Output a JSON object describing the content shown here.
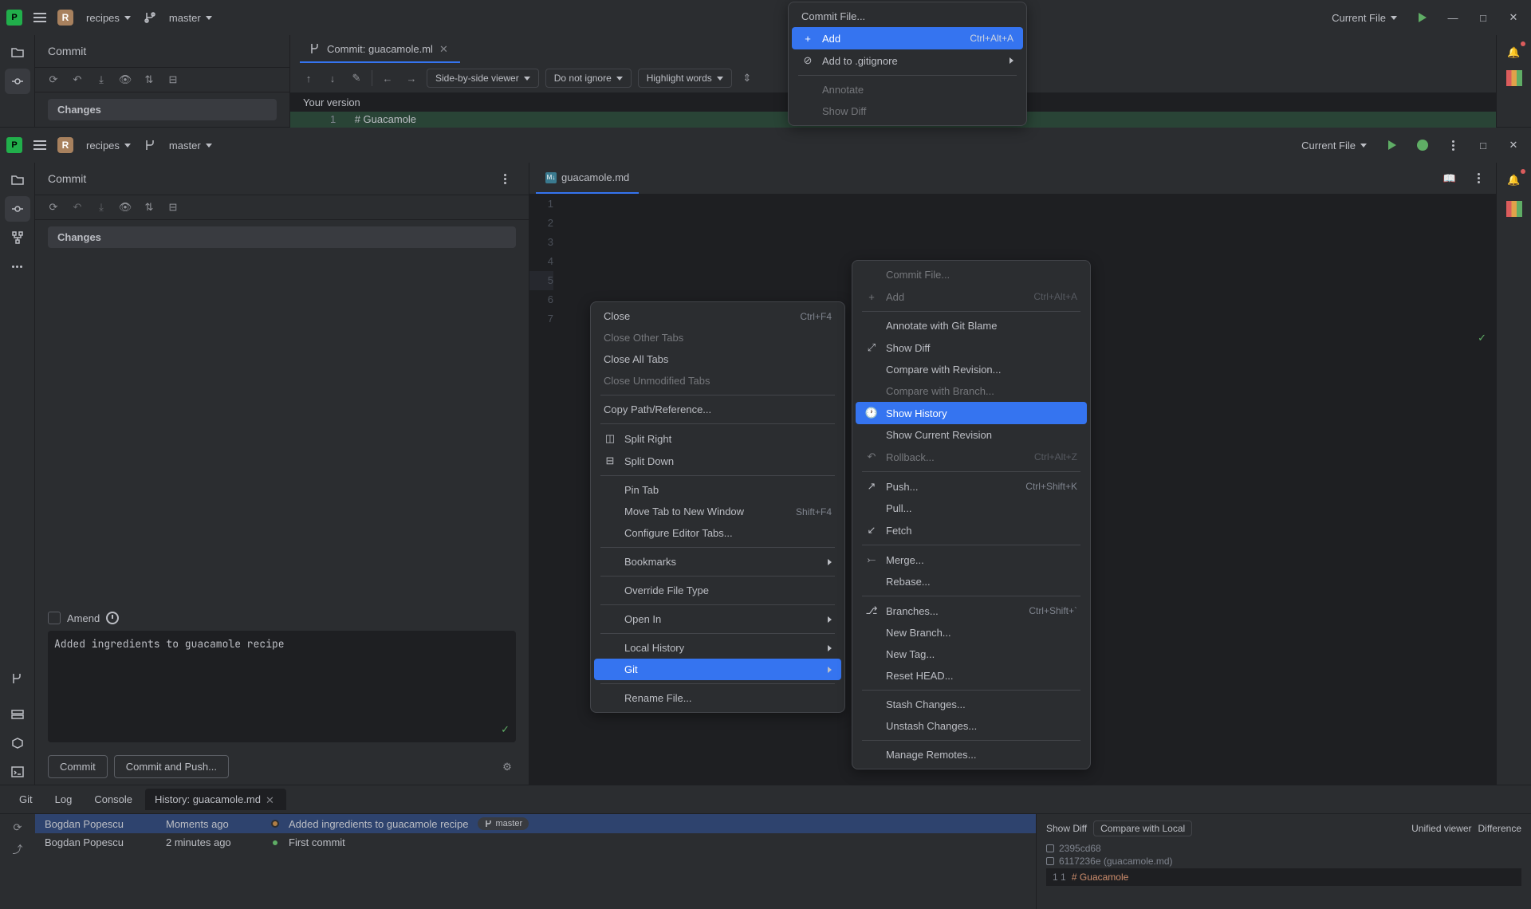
{
  "app": {
    "project_name": "recipes",
    "branch": "master",
    "run_config": "Current File"
  },
  "top_window": {
    "commit_header": "Commit",
    "changes_label": "Changes",
    "tab_label": "Commit: guacamole.ml",
    "viewer_mode": "Side-by-side viewer",
    "ignore_mode": "Do not ignore",
    "highlight_mode": "Highlight words",
    "version_label": "Your version",
    "code_line": "# Guacamole",
    "menu": {
      "commit_file": "Commit File...",
      "add": "Add",
      "add_shortcut": "Ctrl+Alt+A",
      "add_to_gitignore": "Add to .gitignore",
      "annotate": "Annotate",
      "show_diff": "Show Diff"
    }
  },
  "main_window": {
    "commit_header": "Commit",
    "changes_label": "Changes",
    "amend_label": "Amend",
    "commit_message": "Added ingredients to guacamole recipe",
    "commit_btn": "Commit",
    "commit_push_btn": "Commit and Push...",
    "editor_tab": "guacamole.md",
    "gutter_lines": [
      "1",
      "2",
      "3",
      "4",
      "5",
      "6",
      "7"
    ]
  },
  "bottom_tabs": {
    "git": "Git",
    "log": "Log",
    "console": "Console",
    "history": "History: guacamole.md"
  },
  "history": {
    "rows": [
      {
        "author": "Bogdan Popescu",
        "time": "Moments ago",
        "message": "Added ingredients to guacamole recipe",
        "branch": "master"
      },
      {
        "author": "Bogdan Popescu",
        "time": "2 minutes ago",
        "message": "First commit"
      }
    ],
    "right_toolbar": {
      "diff_label": "Show Diff",
      "compare": "Compare with Local",
      "unified": "Unified viewer",
      "difference": "Difference"
    },
    "commit_hashes": [
      "2395cd68",
      "6117236e (guacamole.md)"
    ],
    "diff_line_nums": "1 1",
    "diff_line": "# Guacamole"
  },
  "tab_menu": {
    "close": "Close",
    "close_shortcut": "Ctrl+F4",
    "close_other": "Close Other Tabs",
    "close_all": "Close All Tabs",
    "close_unmodified": "Close Unmodified Tabs",
    "copy_path": "Copy Path/Reference...",
    "split_right": "Split Right",
    "split_down": "Split Down",
    "pin_tab": "Pin Tab",
    "move_tab": "Move Tab to New Window",
    "move_shortcut": "Shift+F4",
    "configure_tabs": "Configure Editor Tabs...",
    "bookmarks": "Bookmarks",
    "override_type": "Override File Type",
    "open_in": "Open In",
    "local_history": "Local History",
    "git": "Git",
    "rename_file": "Rename File..."
  },
  "git_submenu": {
    "commit_file": "Commit File...",
    "add": "Add",
    "add_shortcut": "Ctrl+Alt+A",
    "annotate_blame": "Annotate with Git Blame",
    "show_diff": "Show Diff",
    "compare_revision": "Compare with Revision...",
    "compare_branch": "Compare with Branch...",
    "show_history": "Show History",
    "show_current_revision": "Show Current Revision",
    "rollback": "Rollback...",
    "rollback_shortcut": "Ctrl+Alt+Z",
    "push": "Push...",
    "push_shortcut": "Ctrl+Shift+K",
    "pull": "Pull...",
    "fetch": "Fetch",
    "merge": "Merge...",
    "rebase": "Rebase...",
    "branches": "Branches...",
    "branches_shortcut": "Ctrl+Shift+`",
    "new_branch": "New Branch...",
    "new_tag": "New Tag...",
    "reset_head": "Reset HEAD...",
    "stash": "Stash Changes...",
    "unstash": "Unstash Changes...",
    "manage_remotes": "Manage Remotes..."
  }
}
